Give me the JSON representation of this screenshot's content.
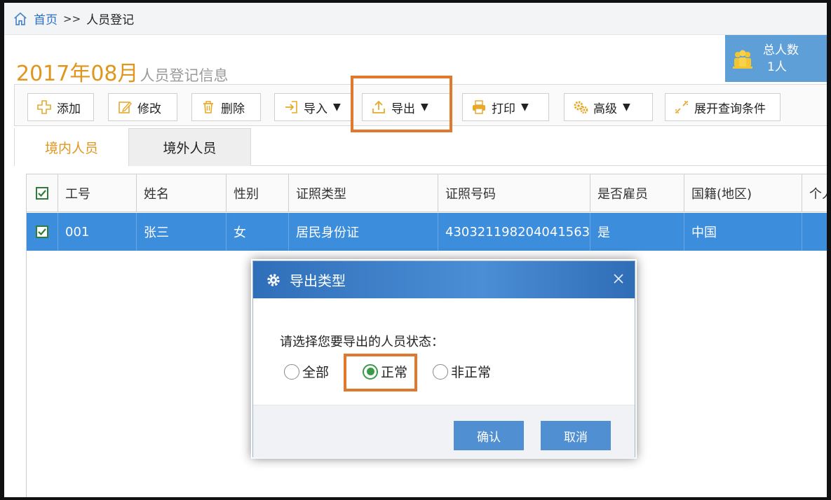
{
  "breadcrumb": {
    "home": "首页",
    "separator": ">>",
    "current": "人员登记"
  },
  "title": {
    "main": "2017年08月",
    "sub": "人员登记信息"
  },
  "summary": {
    "label": "总人数",
    "value": "1人"
  },
  "toolbar": {
    "add": "添加",
    "edit": "修改",
    "delete": "删除",
    "import": "导入",
    "export": "导出",
    "print": "打印",
    "advanced": "高级",
    "expand_query": "展开查询条件",
    "caret": "▼"
  },
  "tabs": {
    "domestic": "境内人员",
    "foreign": "境外人员"
  },
  "table": {
    "headers": [
      "工号",
      "姓名",
      "性别",
      "证照类型",
      "证照号码",
      "是否雇员",
      "国籍(地区)",
      "个人"
    ],
    "rows": [
      [
        "001",
        "张三",
        "女",
        "居民身份证",
        "430321198204041563",
        "是",
        "中国",
        ""
      ]
    ]
  },
  "dialog": {
    "title": "导出类型",
    "prompt": "请选择您要导出的人员状态：",
    "options": [
      "全部",
      "正常",
      "非正常"
    ],
    "selected": "正常",
    "confirm": "确认",
    "cancel": "取消"
  },
  "colors": {
    "accent_orange": "#e0961c",
    "highlight_box": "#e0792d",
    "primary_blue": "#3c8ddc",
    "radio_green": "#3a9a47"
  }
}
